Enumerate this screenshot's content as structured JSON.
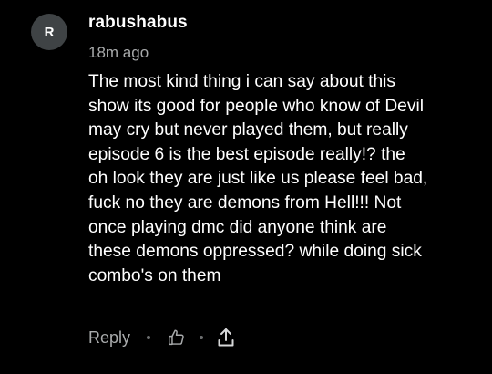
{
  "comment": {
    "avatar_initial": "R",
    "username": "rabushabus",
    "timestamp": "18m ago",
    "body_lines": [
      "The most kind thing i can say about this",
      "show its good for people who know of Devil",
      "may cry but never played them, but really",
      "episode 6 is the best episode really!? the",
      "oh look they are just like us please feel bad,",
      "fuck no they are demons from Hell!!! Not",
      "once playing dmc did anyone think are",
      "these demons oppressed? while doing sick",
      "combo's on them"
    ]
  },
  "actions": {
    "reply_label": "Reply",
    "like_icon": "thumbs-up-icon",
    "share_icon": "share-icon"
  },
  "colors": {
    "background": "#000000",
    "text_primary": "#ffffff",
    "text_secondary": "#a8aaab",
    "avatar_bg": "#3f4345"
  }
}
